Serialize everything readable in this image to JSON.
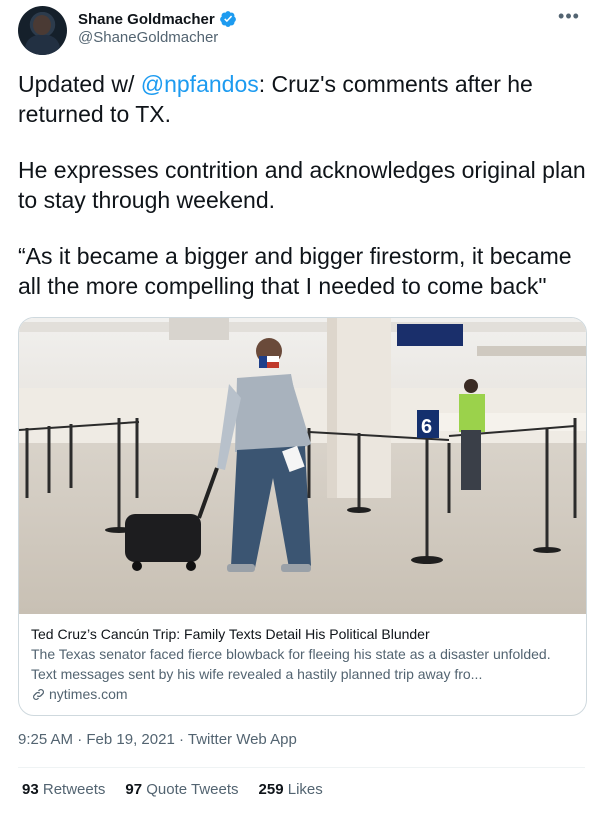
{
  "author": {
    "display_name": "Shane Goldmacher",
    "handle": "@ShaneGoldmacher",
    "verified_icon": "verified-badge-icon",
    "more_icon": "more-horizontal-icon"
  },
  "tweet": {
    "lead_prefix": "Updated w/ ",
    "mention": "@npfandos",
    "lead_suffix": ": Cruz's comments after he returned to TX.",
    "paragraph2": "He expresses contrition and acknowledges original plan to stay through weekend.",
    "paragraph3": "“As it became a bigger and bigger firestorm, it became all the more compelling that I needed to come back\""
  },
  "card": {
    "title": "Ted Cruz’s Cancún Trip: Family Texts Detail His Political Blunder",
    "description": "The Texas senator faced fierce blowback for fleeing his state as a disaster unfolded. Text messages sent by his wife revealed a hastily planned trip away fro...",
    "domain": "nytimes.com",
    "gate_sign": "6"
  },
  "meta": {
    "time": "9:25 AM",
    "separator": " · ",
    "date": "Feb 19, 2021",
    "source": "Twitter Web App"
  },
  "stats": {
    "retweets_count": "93",
    "retweets_label": "Retweets",
    "quotes_count": "97",
    "quotes_label": "Quote Tweets",
    "likes_count": "259",
    "likes_label": "Likes"
  },
  "colors": {
    "accent": "#1d9bf0",
    "text": "#0f1419",
    "secondary": "#536471",
    "border": "#cfd9de"
  }
}
